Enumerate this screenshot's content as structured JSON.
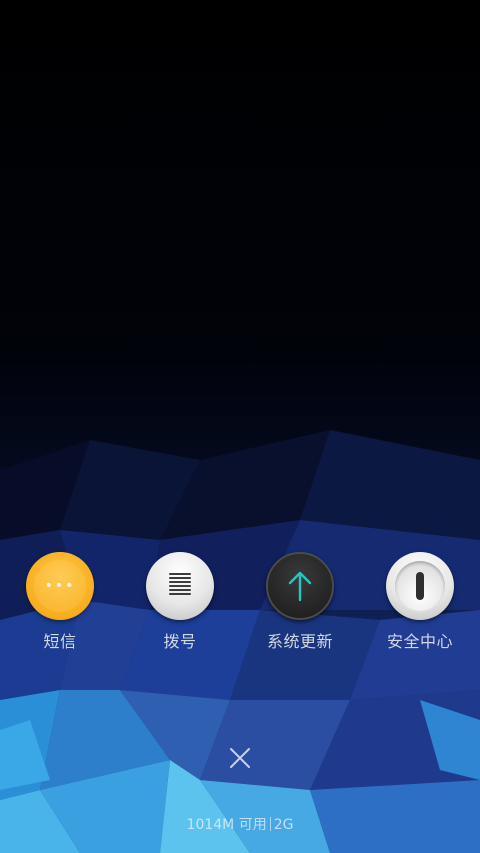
{
  "apps": [
    {
      "label": "短信",
      "icon": "message-icon"
    },
    {
      "label": "拨号",
      "icon": "phone-dialer-icon"
    },
    {
      "label": "系统更新",
      "icon": "system-update-icon"
    },
    {
      "label": "安全中心",
      "icon": "security-center-icon"
    }
  ],
  "close": {
    "icon": "close-icon",
    "glyph": "✕"
  },
  "memory": {
    "available": "1014M 可用",
    "total": "2G"
  },
  "colors": {
    "sms_orange": "#f8ad1c",
    "update_arrow": "#23c7c1",
    "label_text": "#d3d8e4"
  }
}
